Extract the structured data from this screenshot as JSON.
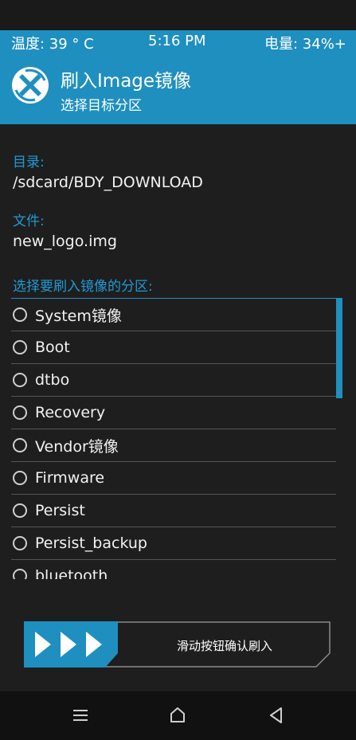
{
  "status": {
    "temperature": "温度: 39 ° C",
    "time": "5:16 PM",
    "battery": "电量: 34%+"
  },
  "header": {
    "title": "刷入Image镜像",
    "subtitle": "选择目标分区"
  },
  "directory": {
    "label": "目录:",
    "value": "/sdcard/BDY_DOWNLOAD"
  },
  "file": {
    "label": "文件:",
    "value": "new_logo.img"
  },
  "partition_prompt": "选择要刷入镜像的分区:",
  "partitions": [
    {
      "label": "System镜像",
      "selected": false
    },
    {
      "label": "Boot",
      "selected": false
    },
    {
      "label": "dtbo",
      "selected": false
    },
    {
      "label": "Recovery",
      "selected": false
    },
    {
      "label": "Vendor镜像",
      "selected": false
    },
    {
      "label": "Firmware",
      "selected": false
    },
    {
      "label": "Persist",
      "selected": false
    },
    {
      "label": "Persist_backup",
      "selected": false
    },
    {
      "label": "bluetooth",
      "selected": false
    }
  ],
  "slider": {
    "label": "滑动按钮确认刷入"
  },
  "nav": {
    "icons": [
      "menu-icon",
      "home-icon",
      "back-icon"
    ]
  },
  "colors": {
    "accent": "#1f8fbf",
    "background": "#1e1e1e"
  }
}
